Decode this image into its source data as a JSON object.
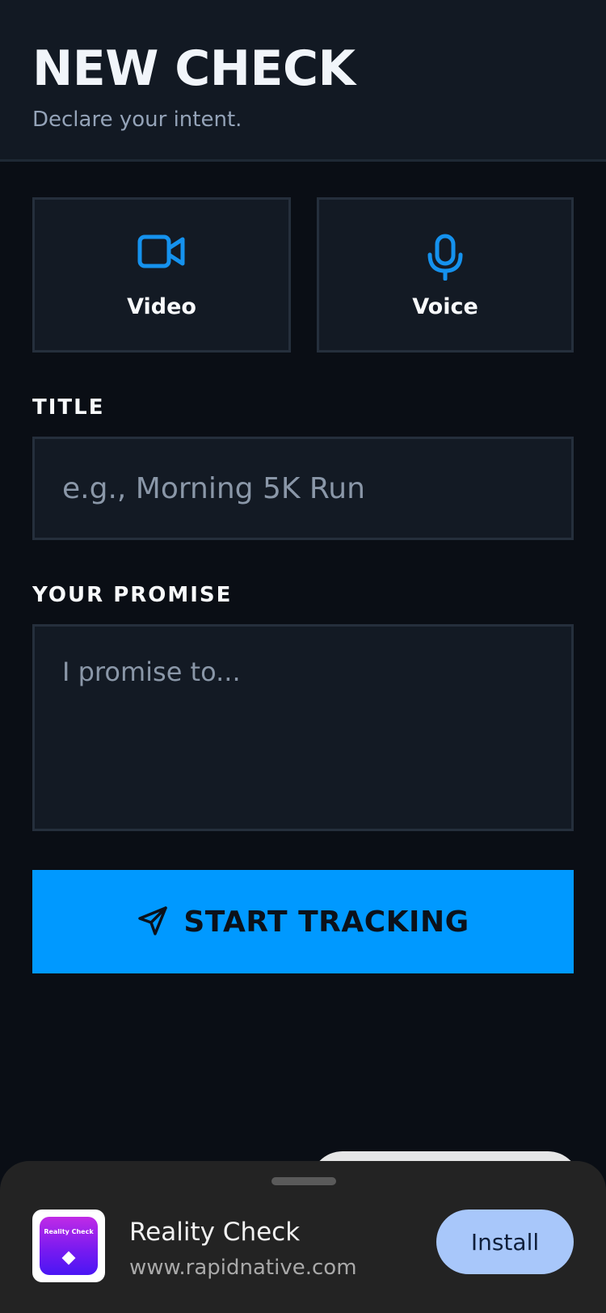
{
  "header": {
    "title": "NEW CHECK",
    "subtitle": "Declare your intent."
  },
  "modes": {
    "video": {
      "label": "Video",
      "icon": "video-camera-icon"
    },
    "voice": {
      "label": "Voice",
      "icon": "microphone-icon"
    }
  },
  "form": {
    "title_label": "TITLE",
    "title_value": "",
    "title_placeholder": "e.g., Morning 5K Run",
    "promise_label": "YOUR PROMISE",
    "promise_value": "",
    "promise_placeholder": "I promise to..."
  },
  "cta": {
    "label": "START TRACKING",
    "icon": "send-icon"
  },
  "install_banner": {
    "icon_text": "Reality Check",
    "app_name": "Reality Check",
    "url": "www.rapidnative.com",
    "install_label": "Install"
  },
  "colors": {
    "accent": "#0099ff",
    "background": "#0a0e15",
    "surface": "#131a24",
    "install_button": "#a8c7fa"
  }
}
